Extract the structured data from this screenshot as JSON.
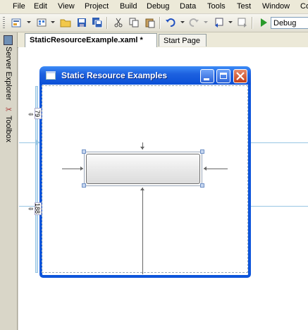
{
  "menu": [
    "File",
    "Edit",
    "View",
    "Project",
    "Build",
    "Debug",
    "Data",
    "Tools",
    "Test",
    "Window",
    "Co"
  ],
  "toolbar": {
    "configuration": "Debug"
  },
  "side_tabs": {
    "server_explorer": "Server Explorer",
    "toolbox": "Toolbox"
  },
  "tabs": [
    {
      "label": "StaticResourceExample.xaml *",
      "active": true
    },
    {
      "label": "Start Page",
      "active": false
    }
  ],
  "window": {
    "title": "Static Resource Examples"
  },
  "grid": {
    "row1_height": "79",
    "row2_height": "188"
  },
  "colors": {
    "title_bar": "#1e62e0",
    "grid_line": "#98c6e3",
    "editor_bg": "#ffffff"
  }
}
